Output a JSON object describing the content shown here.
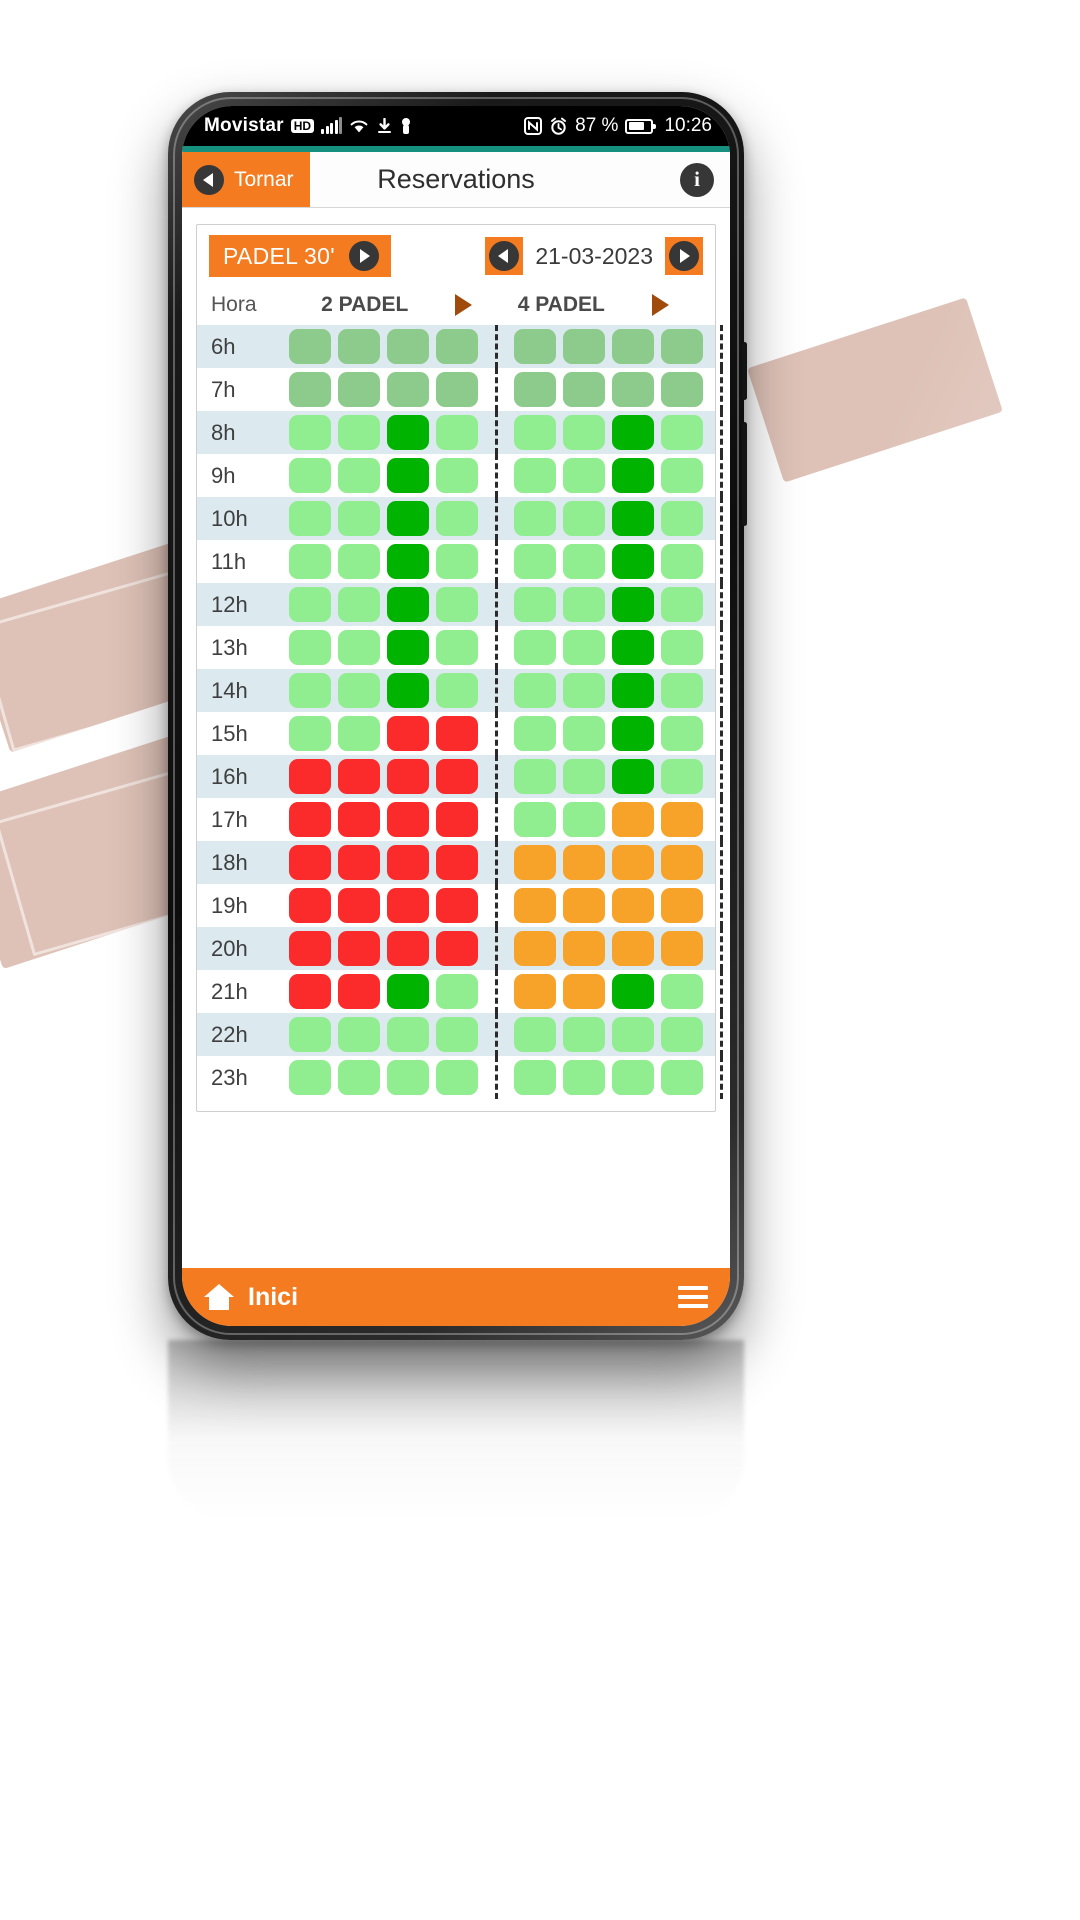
{
  "status_bar": {
    "carrier": "Movistar",
    "network_badge": "HD",
    "icons": [
      "signal-icon",
      "wifi-icon",
      "download-icon",
      "usb-icon",
      "nfc-icon",
      "alarm-icon"
    ],
    "battery_percent": "87 %",
    "clock": "10:26"
  },
  "header": {
    "back_label": "Tornar",
    "title": "Reservations",
    "info_label": "i",
    "accent_color": "#16917f",
    "brand_color": "#f47b20"
  },
  "toolbar": {
    "sport_label": "PADEL 30'",
    "date_label": "21-03-2023"
  },
  "grid": {
    "hora_label": "Hora",
    "columns": [
      {
        "label": "2 PADEL",
        "courts": 4
      },
      {
        "label": "4 PADEL",
        "courts": 4
      },
      {
        "label": "",
        "courts": 1
      }
    ],
    "legend": {
      "free": "#90ee90",
      "dim": "#8ccb8c",
      "mine": "#00b300",
      "busy": "#fb2b2b",
      "partial": "#f7a32a"
    },
    "rows": [
      {
        "hour": "6h",
        "cells": [
          [
            "dim",
            "dim",
            "dim",
            "dim"
          ],
          [
            "dim",
            "dim",
            "dim",
            "dim"
          ],
          [
            "dim"
          ]
        ]
      },
      {
        "hour": "7h",
        "cells": [
          [
            "dim",
            "dim",
            "dim",
            "dim"
          ],
          [
            "dim",
            "dim",
            "dim",
            "dim"
          ],
          [
            "dim"
          ]
        ]
      },
      {
        "hour": "8h",
        "cells": [
          [
            "free",
            "free",
            "mine",
            "free"
          ],
          [
            "free",
            "free",
            "mine",
            "free"
          ],
          [
            "free"
          ]
        ]
      },
      {
        "hour": "9h",
        "cells": [
          [
            "free",
            "free",
            "mine",
            "free"
          ],
          [
            "free",
            "free",
            "mine",
            "free"
          ],
          [
            "free"
          ]
        ]
      },
      {
        "hour": "10h",
        "cells": [
          [
            "free",
            "free",
            "mine",
            "free"
          ],
          [
            "free",
            "free",
            "mine",
            "free"
          ],
          [
            "free"
          ]
        ]
      },
      {
        "hour": "11h",
        "cells": [
          [
            "free",
            "free",
            "mine",
            "free"
          ],
          [
            "free",
            "free",
            "mine",
            "free"
          ],
          [
            "free"
          ]
        ]
      },
      {
        "hour": "12h",
        "cells": [
          [
            "free",
            "free",
            "mine",
            "free"
          ],
          [
            "free",
            "free",
            "mine",
            "free"
          ],
          [
            "free"
          ]
        ]
      },
      {
        "hour": "13h",
        "cells": [
          [
            "free",
            "free",
            "mine",
            "free"
          ],
          [
            "free",
            "free",
            "mine",
            "free"
          ],
          [
            "free"
          ]
        ]
      },
      {
        "hour": "14h",
        "cells": [
          [
            "free",
            "free",
            "mine",
            "free"
          ],
          [
            "free",
            "free",
            "mine",
            "free"
          ],
          [
            "free"
          ]
        ]
      },
      {
        "hour": "15h",
        "cells": [
          [
            "free",
            "free",
            "busy",
            "busy"
          ],
          [
            "free",
            "free",
            "mine",
            "free"
          ],
          [
            "free"
          ]
        ]
      },
      {
        "hour": "16h",
        "cells": [
          [
            "busy",
            "busy",
            "busy",
            "busy"
          ],
          [
            "free",
            "free",
            "mine",
            "free"
          ],
          [
            "free"
          ]
        ]
      },
      {
        "hour": "17h",
        "cells": [
          [
            "busy",
            "busy",
            "busy",
            "busy"
          ],
          [
            "free",
            "free",
            "partial",
            "partial"
          ],
          [
            "free"
          ]
        ]
      },
      {
        "hour": "18h",
        "cells": [
          [
            "busy",
            "busy",
            "busy",
            "busy"
          ],
          [
            "partial",
            "partial",
            "partial",
            "partial"
          ],
          [
            "partial"
          ]
        ]
      },
      {
        "hour": "19h",
        "cells": [
          [
            "busy",
            "busy",
            "busy",
            "busy"
          ],
          [
            "partial",
            "partial",
            "partial",
            "partial"
          ],
          [
            "partial"
          ]
        ]
      },
      {
        "hour": "20h",
        "cells": [
          [
            "busy",
            "busy",
            "busy",
            "busy"
          ],
          [
            "partial",
            "partial",
            "partial",
            "partial"
          ],
          [
            "partial"
          ]
        ]
      },
      {
        "hour": "21h",
        "cells": [
          [
            "busy",
            "busy",
            "mine",
            "free"
          ],
          [
            "partial",
            "partial",
            "mine",
            "free"
          ],
          [
            "busy"
          ]
        ]
      },
      {
        "hour": "22h",
        "cells": [
          [
            "free",
            "free",
            "free",
            "free"
          ],
          [
            "free",
            "free",
            "free",
            "free"
          ],
          [
            "free"
          ]
        ]
      },
      {
        "hour": "23h",
        "cells": [
          [
            "free",
            "free",
            "free",
            "free"
          ],
          [
            "free",
            "free",
            "free",
            "free"
          ],
          [
            "free"
          ]
        ]
      }
    ]
  },
  "footer": {
    "home_label": "Inici",
    "menu_label": "menu"
  }
}
